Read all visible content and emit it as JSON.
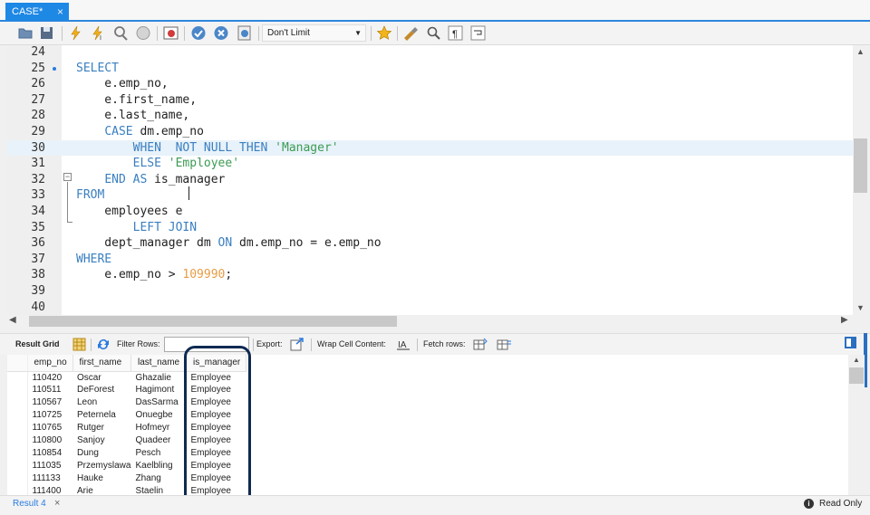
{
  "tab": {
    "title": "CASE*",
    "close": "×"
  },
  "toolbar": {
    "limit_value": "Don't Limit",
    "icons": [
      "open-folder-icon",
      "save-icon",
      "execute-lightning-icon",
      "execute-current-icon",
      "explain-magnifier-icon",
      "stop-icon",
      "toggle-output-icon",
      "commit-check-icon",
      "rollback-x-icon",
      "autocommit-icon",
      "limit-dropdown",
      "bookmark-star-icon",
      "beautify-brush-icon",
      "find-icon",
      "invisible-chars-icon",
      "wrap-lines-icon"
    ]
  },
  "editor": {
    "lines": [
      {
        "n": "24",
        "segments": []
      },
      {
        "n": "25",
        "segments": [
          {
            "t": "SELECT",
            "c": "kw"
          }
        ]
      },
      {
        "n": "26",
        "segments": [
          {
            "t": "    e.emp_no,",
            "c": ""
          }
        ]
      },
      {
        "n": "27",
        "segments": [
          {
            "t": "    e.first_name,",
            "c": ""
          }
        ]
      },
      {
        "n": "28",
        "segments": [
          {
            "t": "    e.last_name,",
            "c": ""
          }
        ]
      },
      {
        "n": "29",
        "segments": [
          {
            "t": "    ",
            "c": ""
          },
          {
            "t": "CASE",
            "c": "kw"
          },
          {
            "t": " dm.emp_no",
            "c": ""
          }
        ]
      },
      {
        "n": "30",
        "segments": [
          {
            "t": "        ",
            "c": ""
          },
          {
            "t": "WHEN  NOT NULL THEN",
            "c": "kw"
          },
          {
            "t": " ",
            "c": ""
          },
          {
            "t": "'Manager'",
            "c": "str"
          }
        ]
      },
      {
        "n": "31",
        "segments": [
          {
            "t": "        ",
            "c": ""
          },
          {
            "t": "ELSE",
            "c": "kw"
          },
          {
            "t": " ",
            "c": ""
          },
          {
            "t": "'Employee'",
            "c": "str"
          }
        ]
      },
      {
        "n": "32",
        "segments": [
          {
            "t": "    ",
            "c": ""
          },
          {
            "t": "END AS",
            "c": "kw"
          },
          {
            "t": " is_manager",
            "c": ""
          }
        ]
      },
      {
        "n": "33",
        "segments": [
          {
            "t": "FROM",
            "c": "kw"
          }
        ]
      },
      {
        "n": "34",
        "segments": [
          {
            "t": "    employees e",
            "c": ""
          }
        ]
      },
      {
        "n": "35",
        "segments": [
          {
            "t": "        ",
            "c": ""
          },
          {
            "t": "LEFT JOIN",
            "c": "kw"
          }
        ]
      },
      {
        "n": "36",
        "segments": [
          {
            "t": "    dept_manager dm ",
            "c": ""
          },
          {
            "t": "ON",
            "c": "kw"
          },
          {
            "t": " dm.emp_no = e.emp_no",
            "c": ""
          }
        ]
      },
      {
        "n": "37",
        "segments": [
          {
            "t": "WHERE",
            "c": "kw"
          }
        ]
      },
      {
        "n": "38",
        "segments": [
          {
            "t": "    e.emp_no > ",
            "c": ""
          },
          {
            "t": "109990",
            "c": "num-lit"
          },
          {
            "t": ";",
            "c": ""
          }
        ]
      },
      {
        "n": "39",
        "segments": []
      },
      {
        "n": "40",
        "segments": []
      }
    ],
    "current_line": "30"
  },
  "result_toolbar": {
    "result_grid": "Result Grid",
    "filter_rows": "Filter Rows:",
    "export": "Export:",
    "wrap_cell": "Wrap Cell Content:",
    "fetch_rows": "Fetch rows:"
  },
  "grid": {
    "columns": [
      "emp_no",
      "first_name",
      "last_name",
      "is_manager"
    ],
    "rows": [
      [
        "110420",
        "Oscar",
        "Ghazalie",
        "Employee"
      ],
      [
        "110511",
        "DeForest",
        "Hagimont",
        "Employee"
      ],
      [
        "110567",
        "Leon",
        "DasSarma",
        "Employee"
      ],
      [
        "110725",
        "Peternela",
        "Onuegbe",
        "Employee"
      ],
      [
        "110765",
        "Rutger",
        "Hofmeyr",
        "Employee"
      ],
      [
        "110800",
        "Sanjoy",
        "Quadeer",
        "Employee"
      ],
      [
        "110854",
        "Dung",
        "Pesch",
        "Employee"
      ],
      [
        "111035",
        "Przemyslawa",
        "Kaelbling",
        "Employee"
      ],
      [
        "111133",
        "Hauke",
        "Zhang",
        "Employee"
      ],
      [
        "111400",
        "Arie",
        "Staelin",
        "Employee"
      ]
    ]
  },
  "status": {
    "result_tab": "Result 4",
    "close": "×",
    "read_only": "Read Only"
  }
}
